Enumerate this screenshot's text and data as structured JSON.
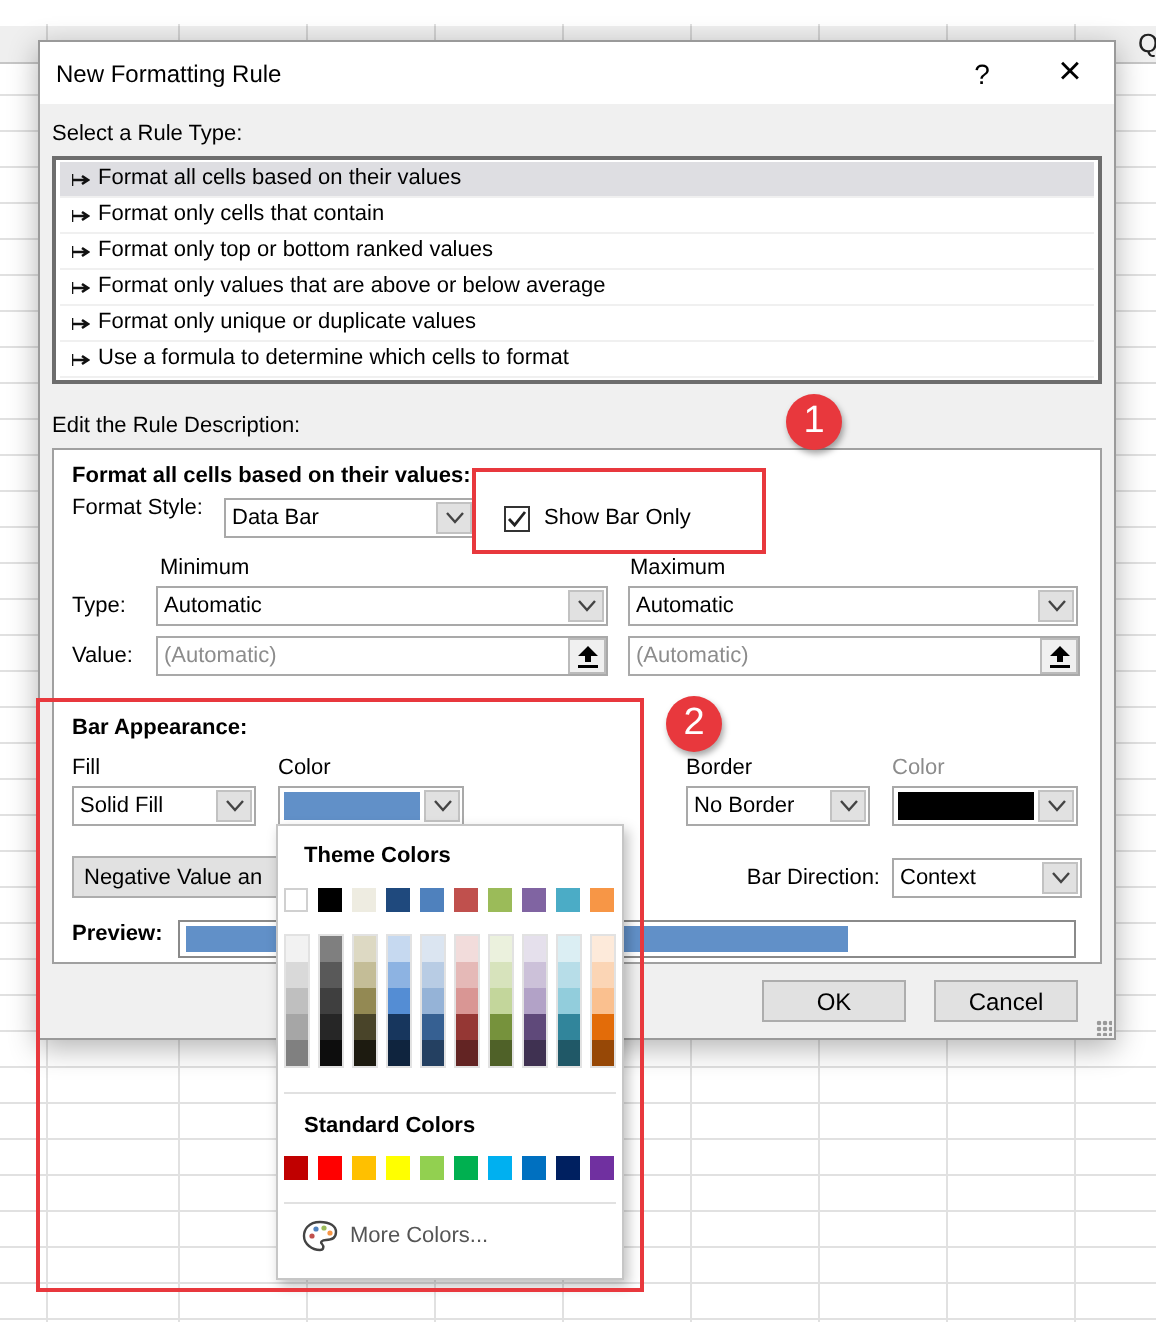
{
  "sheet": {
    "visible_column_header": "Q"
  },
  "dialog": {
    "title": "New Formatting Rule",
    "help": "?",
    "close": "×",
    "rule_type_label": "Select a Rule Type:",
    "rule_types": [
      {
        "label": "Format all cells based on their values",
        "selected": true
      },
      {
        "label": "Format only cells that contain",
        "selected": false
      },
      {
        "label": "Format only top or bottom ranked values",
        "selected": false
      },
      {
        "label": "Format only values that are above or below average",
        "selected": false
      },
      {
        "label": "Format only unique or duplicate values",
        "selected": false
      },
      {
        "label": "Use a formula to determine which cells to format",
        "selected": false
      }
    ],
    "description_label": "Edit the Rule Description:",
    "description_heading": "Format all cells based on their values:",
    "format_style": {
      "label": "Format Style:",
      "value": "Data Bar"
    },
    "show_bar_only": {
      "label": "Show Bar Only",
      "checked": true
    },
    "minimum": {
      "heading": "Minimum",
      "type": "Automatic",
      "value_placeholder": "(Automatic)"
    },
    "maximum": {
      "heading": "Maximum",
      "type": "Automatic",
      "value_placeholder": "(Automatic)"
    },
    "type_label": "Type:",
    "value_label": "Value:",
    "bar_appearance": {
      "heading": "Bar Appearance:",
      "fill": {
        "label": "Fill",
        "value": "Solid Fill"
      },
      "fill_color": {
        "label": "Color",
        "color": "#6190c8"
      },
      "border": {
        "label": "Border",
        "value": "No Border"
      },
      "border_color": {
        "label": "Color",
        "color": "#000000",
        "disabled": true
      },
      "negative_button": "Negative Value an",
      "bar_direction": {
        "label": "Bar Direction:",
        "value": "Context"
      },
      "preview": {
        "label": "Preview:",
        "level": 0.75
      }
    },
    "buttons": [
      "OK",
      "Cancel"
    ]
  },
  "color_menu": {
    "theme_heading": "Theme Colors",
    "theme_colors": [
      {
        "color": "#ffffff"
      },
      {
        "color": "#000000"
      },
      {
        "color": "#eeece1"
      },
      {
        "color": "#1f497d"
      },
      {
        "color": "#4f81bd"
      },
      {
        "color": "#c0504d"
      },
      {
        "color": "#9bbb59"
      },
      {
        "color": "#8064a2"
      },
      {
        "color": "#4bacc6"
      },
      {
        "color": "#f79646"
      }
    ],
    "shade_columns": [
      {
        "shades": [
          {
            "color": "#f2f2f2"
          },
          {
            "color": "#d9d9d9"
          },
          {
            "color": "#bfbfbf"
          },
          {
            "color": "#a6a6a6"
          },
          {
            "color": "#808080"
          }
        ]
      },
      {
        "shades": [
          {
            "color": "#7f7f7f"
          },
          {
            "color": "#595959"
          },
          {
            "color": "#3f3f3f"
          },
          {
            "color": "#262626"
          },
          {
            "color": "#0d0d0d"
          }
        ]
      },
      {
        "shades": [
          {
            "color": "#ddd9c3"
          },
          {
            "color": "#c4bd97"
          },
          {
            "color": "#938953"
          },
          {
            "color": "#494429"
          },
          {
            "color": "#1d1b10"
          }
        ]
      },
      {
        "shades": [
          {
            "color": "#c6d9f0"
          },
          {
            "color": "#8db3e2"
          },
          {
            "color": "#548dd4"
          },
          {
            "color": "#17365d"
          },
          {
            "color": "#0f243e"
          }
        ]
      },
      {
        "shades": [
          {
            "color": "#dbe5f1"
          },
          {
            "color": "#b8cce4"
          },
          {
            "color": "#95b3d7"
          },
          {
            "color": "#366092"
          },
          {
            "color": "#244061"
          }
        ]
      },
      {
        "shades": [
          {
            "color": "#f2dcdb"
          },
          {
            "color": "#e5b9b7"
          },
          {
            "color": "#d99694"
          },
          {
            "color": "#953734"
          },
          {
            "color": "#632423"
          }
        ]
      },
      {
        "shades": [
          {
            "color": "#ebf1dd"
          },
          {
            "color": "#d7e3bc"
          },
          {
            "color": "#c3d69b"
          },
          {
            "color": "#76923c"
          },
          {
            "color": "#4f6128"
          }
        ]
      },
      {
        "shades": [
          {
            "color": "#e5e0ec"
          },
          {
            "color": "#ccc1d9"
          },
          {
            "color": "#b2a2c7"
          },
          {
            "color": "#5f497a"
          },
          {
            "color": "#3f3151"
          }
        ]
      },
      {
        "shades": [
          {
            "color": "#dbeef3"
          },
          {
            "color": "#b7dde8"
          },
          {
            "color": "#92cddc"
          },
          {
            "color": "#31859b"
          },
          {
            "color": "#205867"
          }
        ]
      },
      {
        "shades": [
          {
            "color": "#fdeada"
          },
          {
            "color": "#fbd5b5"
          },
          {
            "color": "#fac08f"
          },
          {
            "color": "#e36c09"
          },
          {
            "color": "#974806"
          }
        ]
      }
    ],
    "standard_heading": "Standard Colors",
    "standard_colors": [
      {
        "color": "#c00000"
      },
      {
        "color": "#ff0000"
      },
      {
        "color": "#ffc000"
      },
      {
        "color": "#ffff00"
      },
      {
        "color": "#92d050"
      },
      {
        "color": "#00b050"
      },
      {
        "color": "#00b0f0"
      },
      {
        "color": "#0070c0"
      },
      {
        "color": "#002060"
      },
      {
        "color": "#7030a0"
      }
    ],
    "more_colors": "More Colors..."
  },
  "annotations": [
    {
      "number": "1"
    },
    {
      "number": "2"
    }
  ]
}
